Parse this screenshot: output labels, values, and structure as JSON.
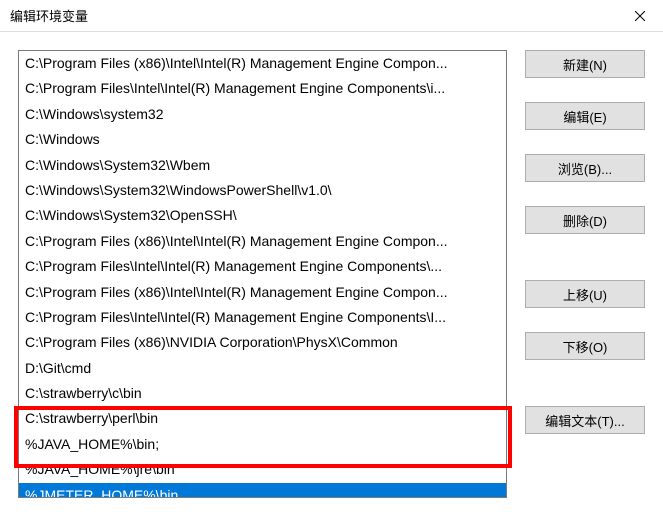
{
  "window": {
    "title": "编辑环境变量"
  },
  "list": {
    "items": [
      "C:\\Program Files (x86)\\Intel\\Intel(R) Management Engine Compon...",
      "C:\\Program Files\\Intel\\Intel(R) Management Engine Components\\i...",
      "C:\\Windows\\system32",
      "C:\\Windows",
      "C:\\Windows\\System32\\Wbem",
      "C:\\Windows\\System32\\WindowsPowerShell\\v1.0\\",
      "C:\\Windows\\System32\\OpenSSH\\",
      "C:\\Program Files (x86)\\Intel\\Intel(R) Management Engine Compon...",
      "C:\\Program Files\\Intel\\Intel(R) Management Engine Components\\...",
      "C:\\Program Files (x86)\\Intel\\Intel(R) Management Engine Compon...",
      "C:\\Program Files\\Intel\\Intel(R) Management Engine Components\\I...",
      "C:\\Program Files (x86)\\NVIDIA Corporation\\PhysX\\Common",
      "D:\\Git\\cmd",
      "C:\\strawberry\\c\\bin",
      "C:\\strawberry\\perl\\bin",
      "%JAVA_HOME%\\bin;",
      "%JAVA_HOME%\\jre\\bin",
      "%JMETER_HOME%\\bin"
    ],
    "selected_index": 17
  },
  "buttons": {
    "new": "新建(N)",
    "edit": "编辑(E)",
    "browse": "浏览(B)...",
    "delete": "删除(D)",
    "move_up": "上移(U)",
    "move_down": "下移(O)",
    "edit_text": "编辑文本(T)..."
  }
}
